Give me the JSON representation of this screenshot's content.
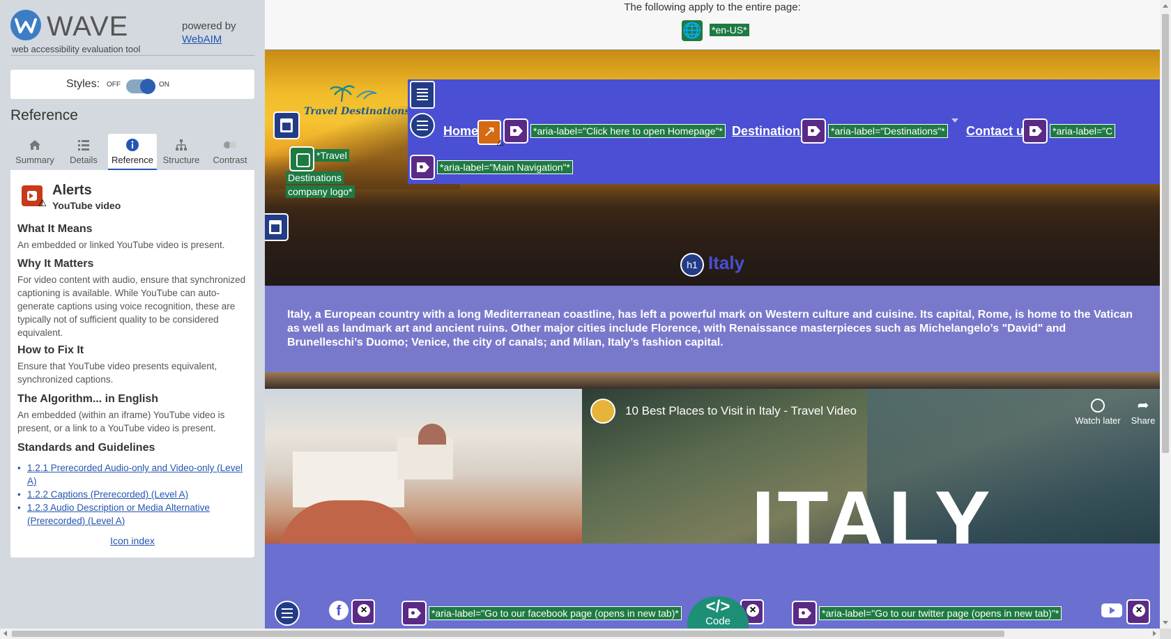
{
  "wave": {
    "app_name": "WAVE",
    "tagline": "web accessibility evaluation tool",
    "powered_by": "powered by",
    "webaim_link": "WebAIM",
    "styles_label": "Styles:",
    "styles_off": "OFF",
    "styles_on": "ON",
    "styles_enabled": true,
    "reference_heading": "Reference",
    "tabs": [
      {
        "label": "Summary",
        "icon": "home-icon"
      },
      {
        "label": "Details",
        "icon": "list-icon"
      },
      {
        "label": "Reference",
        "icon": "info-icon",
        "active": true
      },
      {
        "label": "Structure",
        "icon": "structure-icon"
      },
      {
        "label": "Contrast",
        "icon": "contrast-icon"
      }
    ],
    "alert": {
      "title": "Alerts",
      "subtitle": "YouTube video",
      "what_heading": "What It Means",
      "what_text": "An embedded or linked YouTube video is present.",
      "why_heading": "Why It Matters",
      "why_text": "For video content with audio, ensure that synchronized captioning is available. While YouTube can auto-generate captions using voice recognition, these are typically not of sufficient quality to be considered equivalent.",
      "fix_heading": "How to Fix It",
      "fix_text": "Ensure that YouTube video presents equivalent, synchronized captions.",
      "algo_heading": "The Algorithm... in English",
      "algo_text": "An embedded (within an iframe) YouTube video is present, or a link to a YouTube video is present.",
      "standards_heading": "Standards and Guidelines",
      "standards": [
        "1.2.1 Prerecorded Audio-only and Video-only (Level A)",
        "1.2.2 Captions (Prerecorded) (Level A)",
        "1.2.3 Audio Description or Media Alternative (Prerecorded) (Level A)"
      ],
      "icon_index": "Icon index"
    }
  },
  "page": {
    "topbar_text": "The following apply to the entire page:",
    "lang_tag": "*en-US*",
    "logo_text": "Travel Destinations",
    "logo_alt_1": "*Travel",
    "logo_alt_2": "Destinations",
    "logo_alt_3": "company logo*",
    "nav": {
      "home": "Home",
      "home_aria": "*aria-label=\"Click here to open Homepage\"*",
      "destinations": "Destinations",
      "destinations_aria": "*aria-label=\"Destinations\"*",
      "contact": "Contact us",
      "contact_aria": "*aria-label=\"C",
      "main_nav_aria": "*aria-label=\"Main Navigation\"*"
    },
    "h1_badge": "h1",
    "heading": "Italy",
    "intro": "Italy, a European country with a long Mediterranean coastline, has left a powerful mark on Western culture and cuisine. Its capital, Rome, is home to the Vatican as well as landmark art and ancient ruins. Other major cities include Florence, with Renaissance masterpieces such as Michelangelo’s \"David\" and Brunelleschi’s Duomo; Venice, the city of canals; and Milan, Italy’s fashion capital.",
    "video": {
      "title": "10 Best Places to Visit in Italy - Travel Video",
      "watch_later": "Watch later",
      "share": "Share",
      "overlay_word": "ITALY"
    },
    "footer": {
      "facebook_aria": "*aria-label=\"Go to our facebook page (opens in new tab)*",
      "twitter_aria": "*aria-label=\"Go to our twitter page (opens in new tab)\"*"
    },
    "code_button": {
      "symbol": "</>",
      "label": "Code"
    }
  },
  "colors": {
    "nav_bg": "#4a4fd3",
    "wave_green": "#1e7a42",
    "wave_purple": "#5a2a86",
    "wave_navy": "#233c86",
    "link_blue": "#2455b0"
  }
}
